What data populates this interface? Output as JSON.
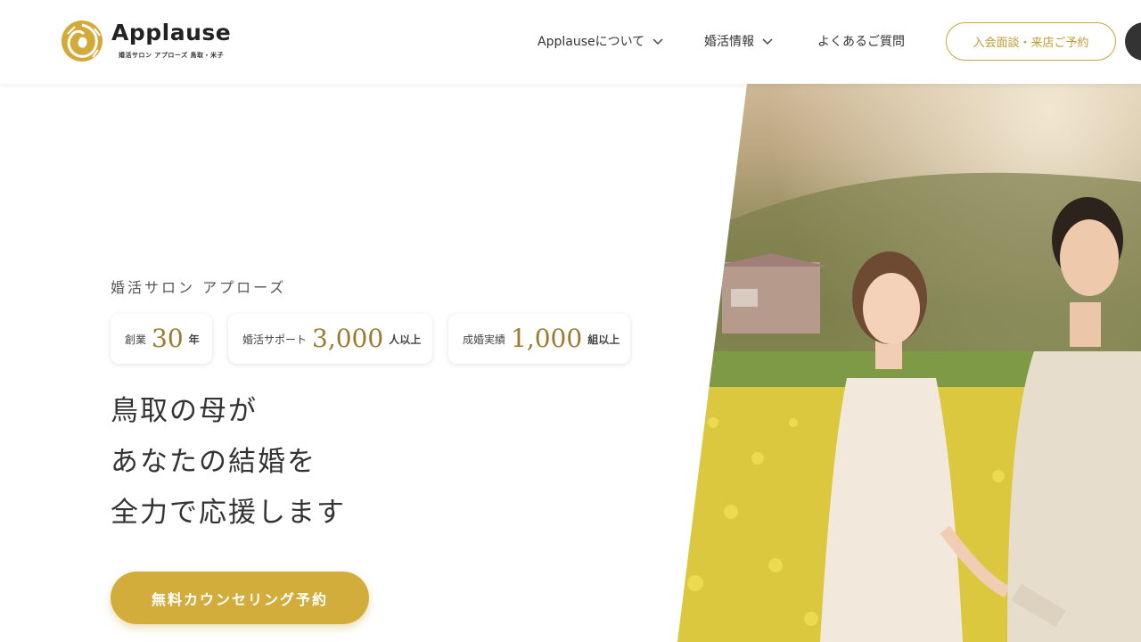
{
  "brand": {
    "name": "Applause",
    "subtitle": "婚活サロン アプローズ 鳥取・米子",
    "logo_color": "#d3a93a"
  },
  "nav": {
    "items": [
      {
        "label": "Applauseについて",
        "has_dropdown": true
      },
      {
        "label": "婚活情報",
        "has_dropdown": true
      },
      {
        "label": "よくあるご質問",
        "has_dropdown": false
      }
    ],
    "cta_label": "入会面談・来店ご予約",
    "menu_icon": "menu-icon"
  },
  "hero": {
    "eyebrow": "婚活サロン アプローズ",
    "badges": [
      {
        "label": "創業",
        "number": "30",
        "unit": "年"
      },
      {
        "label": "婚活サポート",
        "number": "3,000",
        "unit": "人以上"
      },
      {
        "label": "成婚実績",
        "number": "1,000",
        "unit": "組以上"
      }
    ],
    "headline": [
      "鳥取の母が",
      "あなたの結婚を",
      "全力で応援します"
    ],
    "cta_label": "無料カウンセリング予約",
    "accent_color": "#d3ad3c"
  }
}
